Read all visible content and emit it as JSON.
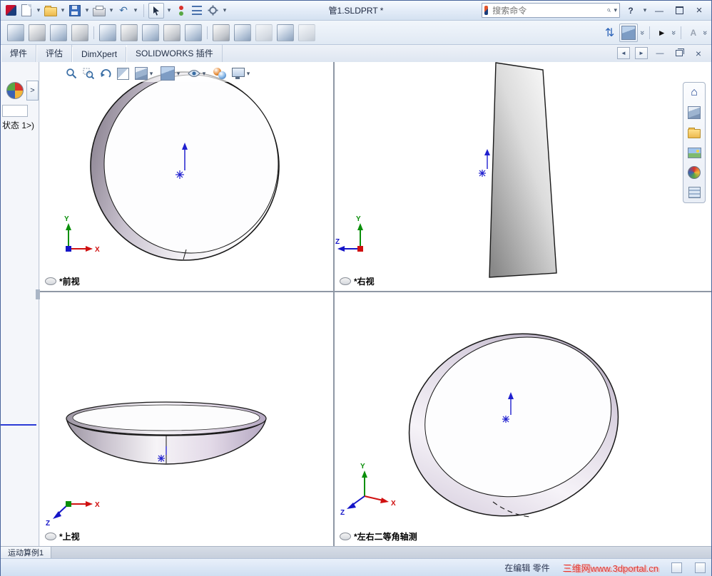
{
  "titlebar": {
    "title": "管1.SLDPRT *",
    "search_placeholder": "搜索命令",
    "help_label": "?"
  },
  "icons": {
    "dropdown": "▾",
    "double_chevron": "»",
    "play": "►",
    "undo": "↶",
    "updown": "⇅",
    "home": "⌂",
    "expand": ">",
    "minimize": "—",
    "close": "×",
    "letter_a": "A",
    "nav_left": "◄",
    "nav_right": "►"
  },
  "tabs": {
    "items": [
      {
        "label": "焊件"
      },
      {
        "label": "评估"
      },
      {
        "label": "DimXpert"
      },
      {
        "label": "SOLIDWORKS 插件"
      }
    ]
  },
  "left_panel": {
    "state_text": "状态 1>)"
  },
  "viewports": {
    "front": {
      "label": "*前视"
    },
    "right": {
      "label": "*右视"
    },
    "top": {
      "label": "*上视"
    },
    "iso": {
      "label": "*左右二等角轴测"
    }
  },
  "axis_labels": {
    "x": "X",
    "y": "Y",
    "z": "Z"
  },
  "bottom": {
    "motion_tab": "运动算例1",
    "status_editing": "在编辑 零件",
    "watermark": "三维网www.3dportal.cn"
  },
  "colors": {
    "accent_blue": "#2a62b8",
    "watermark_red": "#e23a33",
    "band_purple": "#b3a6c0",
    "viewport_bg": "#ffffff"
  }
}
